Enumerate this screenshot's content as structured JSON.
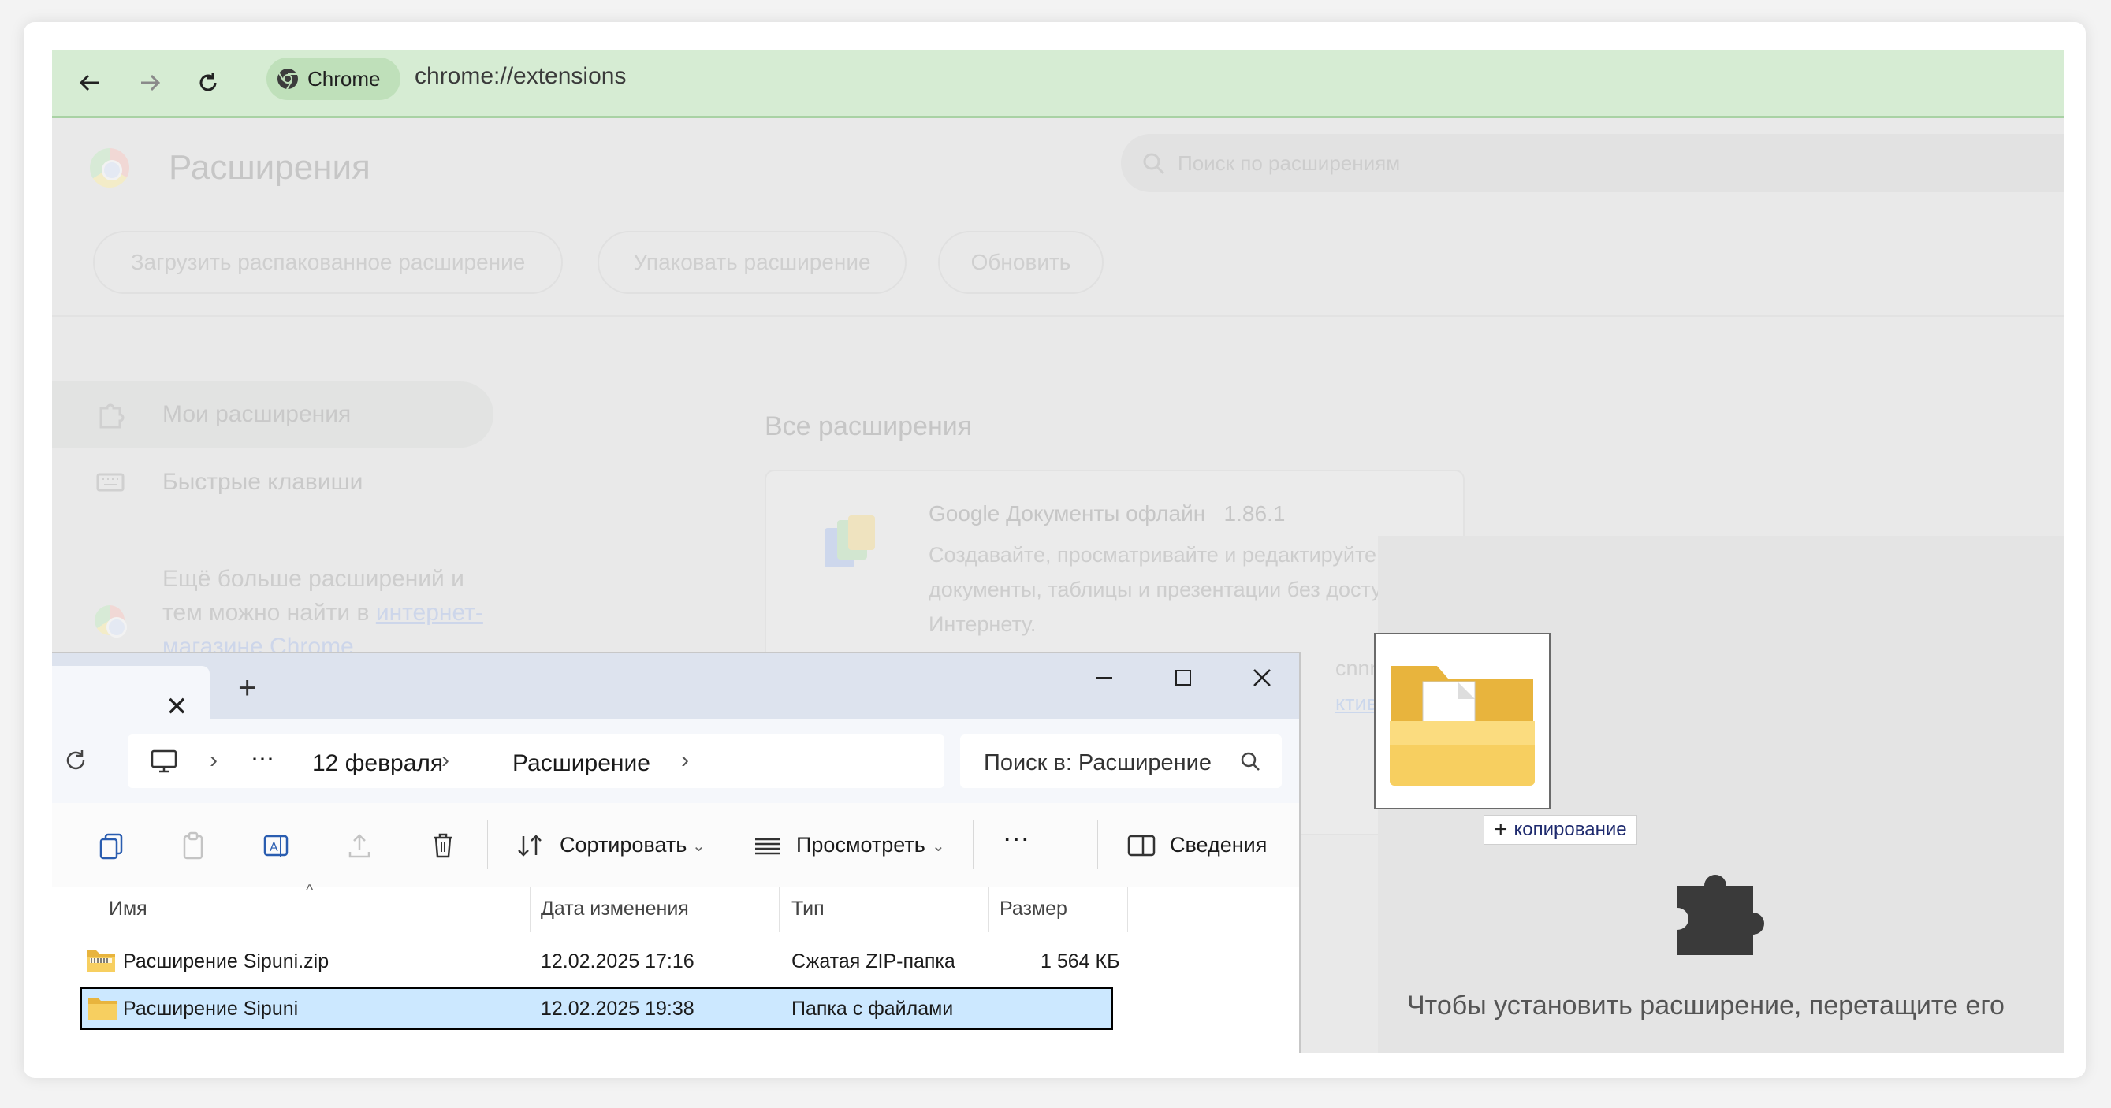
{
  "browser": {
    "chip_label": "Chrome",
    "url": "chrome://extensions"
  },
  "extensions_page": {
    "title": "Расширения",
    "search_placeholder": "Поиск по расширениям",
    "dev_buttons": [
      "Загрузить распакованное расширение",
      "Упаковать расширение",
      "Обновить"
    ],
    "sidebar": {
      "my_extensions": "Мои расширения",
      "shortcuts": "Быстрые клавиши",
      "note_text": "Ещё больше расширений и тем можно найти в",
      "note_link": "интернет-магазине Chrome"
    },
    "all_extensions_heading": "Все расширения",
    "card": {
      "name": "Google Документы офлайн",
      "version": "1.86.1",
      "description": "Создавайте, просматривайте и редактируйте документы, таблицы и презентации без доступа к Интернету.",
      "partial_line1": "cnnnlh",
      "partial_link": "ктивно"
    },
    "drop_text": "Чтобы установить расширение, перетащите его"
  },
  "drag": {
    "badge_label": "копирование"
  },
  "explorer": {
    "breadcrumb": [
      "12 февраля",
      "Расширение"
    ],
    "search_placeholder": "Поиск в: Расширение",
    "commands": {
      "sort": "Сортировать",
      "view": "Просмотреть",
      "details": "Сведения"
    },
    "columns": [
      "Имя",
      "Дата изменения",
      "Тип",
      "Размер"
    ],
    "files": [
      {
        "name": "Расширение Sipuni.zip",
        "date": "12.02.2025 17:16",
        "type": "Сжатая ZIP-папка",
        "size": "1 564 КБ",
        "icon": "zip-folder-icon"
      },
      {
        "name": "Расширение Sipuni",
        "date": "12.02.2025 19:38",
        "type": "Папка с файлами",
        "size": "",
        "icon": "folder-icon",
        "selected": true
      }
    ]
  },
  "colors": {
    "toolbar_bg": "#d6ecd3",
    "selection_bg": "#cce8ff",
    "folder_yellow": "#f7c84b"
  }
}
